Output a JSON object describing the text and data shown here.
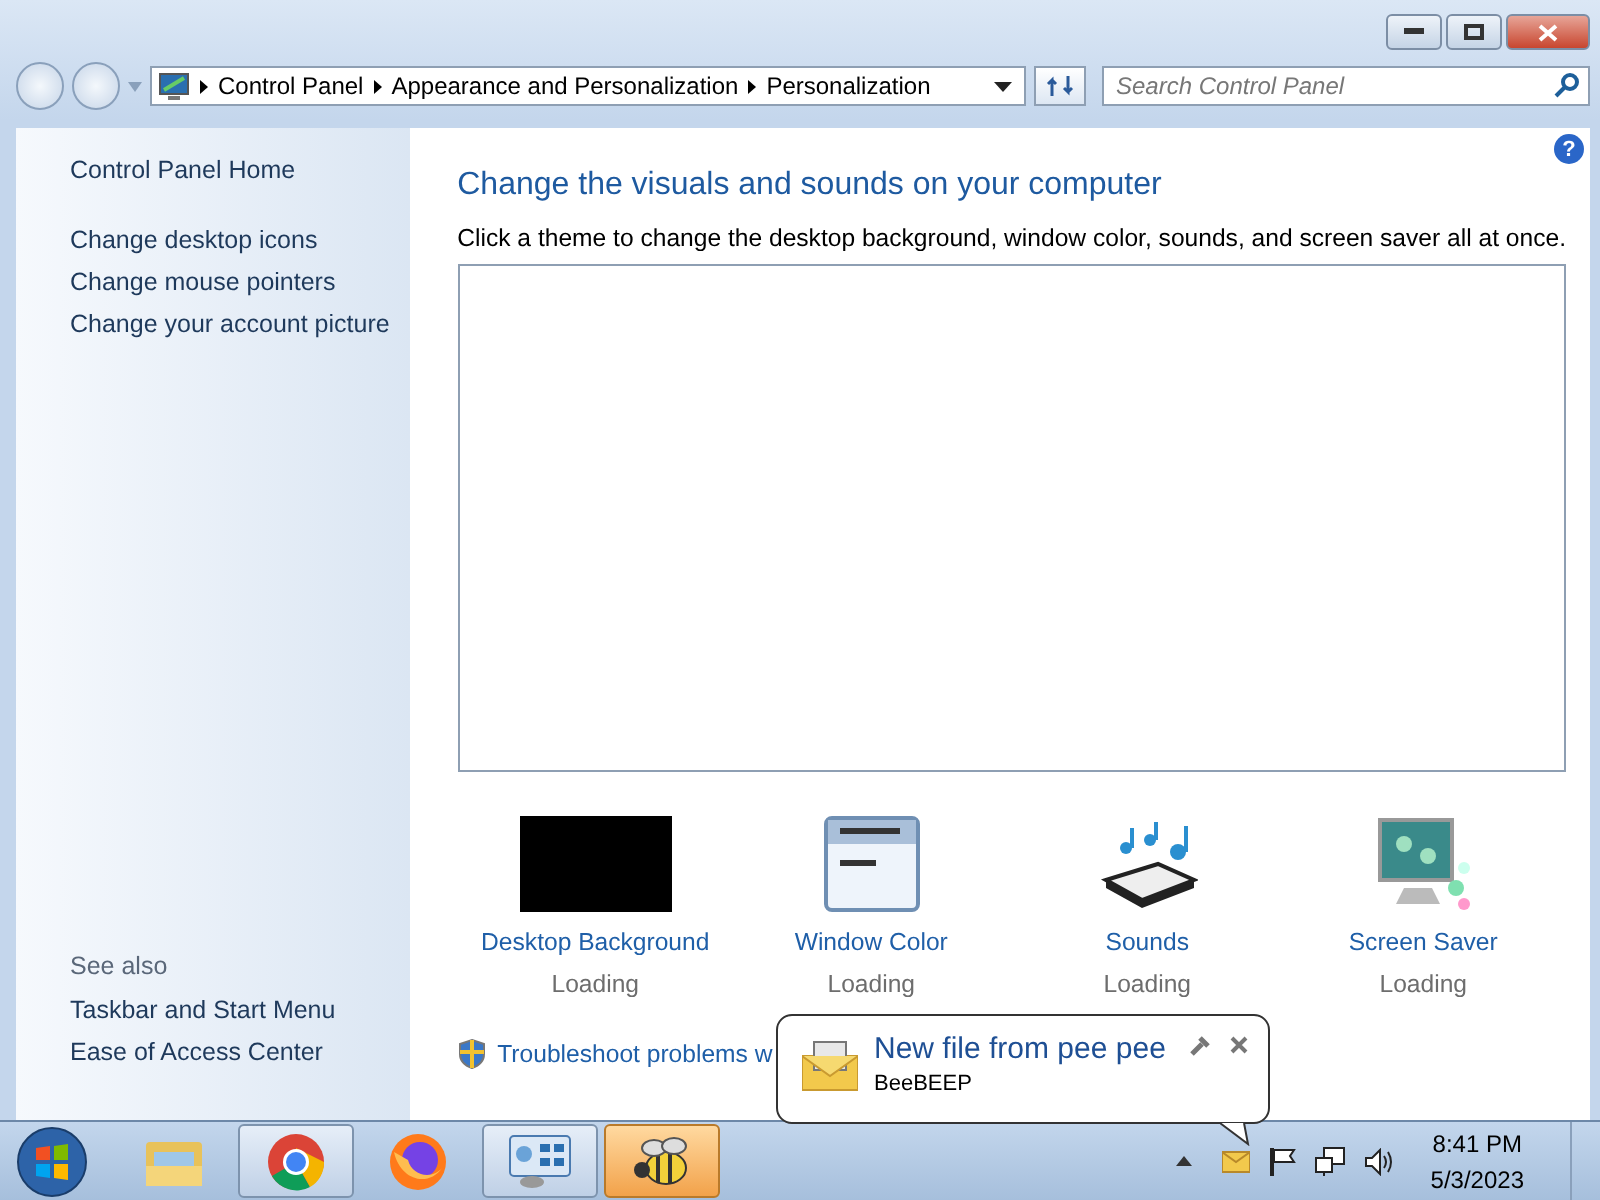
{
  "navigation": {
    "breadcrumb": [
      "Control Panel",
      "Appearance and Personalization",
      "Personalization"
    ],
    "search": {
      "placeholder": "Search Control Panel"
    }
  },
  "sidebar": {
    "home": "Control Panel Home",
    "tasks": [
      "Change desktop icons",
      "Change mouse pointers",
      "Change your account picture"
    ],
    "see_also_title": "See also",
    "see_also": [
      "Taskbar and Start Menu",
      "Ease of Access Center"
    ]
  },
  "content": {
    "help": "?",
    "title": "Change the visuals and sounds on your computer",
    "description": "Click a theme to change the desktop background, window color, sounds, and screen saver all at once.",
    "items": [
      {
        "kind": "background",
        "label": "Desktop Background",
        "status": "Loading"
      },
      {
        "kind": "color",
        "label": "Window Color",
        "status": "Loading"
      },
      {
        "kind": "sounds",
        "label": "Sounds",
        "status": "Loading"
      },
      {
        "kind": "saver",
        "label": "Screen Saver",
        "status": "Loading"
      }
    ],
    "troubleshoot": "Troubleshoot problems w"
  },
  "notification": {
    "title": "New file from pee pee",
    "app": "BeeBEEP"
  },
  "taskbar": {
    "apps": [
      {
        "kind": "explorer",
        "running": false,
        "attention": false
      },
      {
        "kind": "chrome",
        "running": true,
        "attention": false
      },
      {
        "kind": "firefox",
        "running": false,
        "attention": false
      },
      {
        "kind": "control-panel",
        "running": true,
        "attention": false
      },
      {
        "kind": "beebeep",
        "running": true,
        "attention": true
      }
    ],
    "clock": {
      "time": "8:41 PM",
      "date": "5/3/2023"
    }
  }
}
